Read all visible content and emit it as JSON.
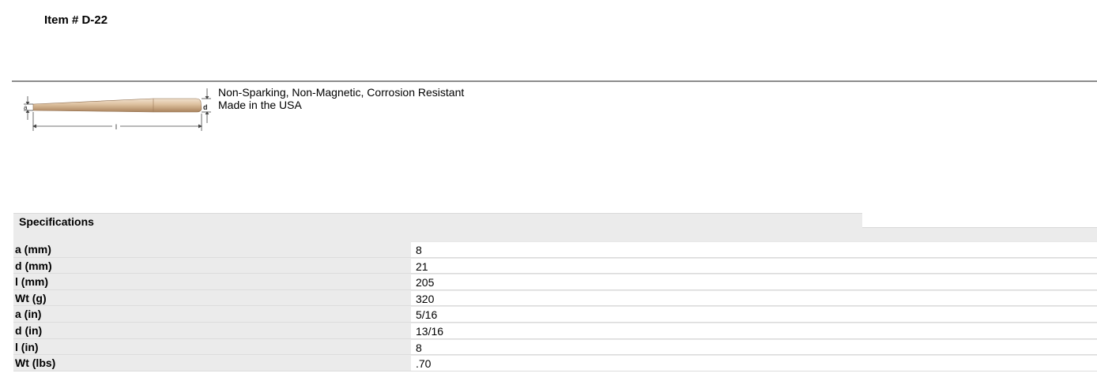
{
  "item": {
    "title": "Item # D-22"
  },
  "figure": {
    "dim_a": "a",
    "dim_d": "d",
    "dim_l": "l",
    "colors": {
      "metal_light": "#e8d2b8",
      "metal_dark": "#b08a64",
      "dimension_line": "#444444"
    }
  },
  "features": [
    "Non-Sparking, Non-Magnetic, Corrosion Resistant",
    "Made in the USA"
  ],
  "specifications": {
    "title": "Specifications",
    "rows": [
      {
        "label": "a (mm)",
        "value": "8"
      },
      {
        "label": "d (mm)",
        "value": "21"
      },
      {
        "label": "l (mm)",
        "value": "205"
      },
      {
        "label": "Wt (g)",
        "value": "320"
      },
      {
        "label": "a (in)",
        "value": "5/16"
      },
      {
        "label": "d (in)",
        "value": "13/16"
      },
      {
        "label": "l (in)",
        "value": "8"
      },
      {
        "label": "Wt (lbs)",
        "value": ".70"
      }
    ]
  }
}
